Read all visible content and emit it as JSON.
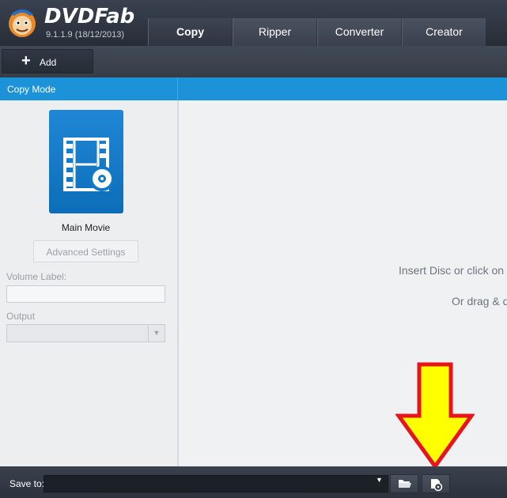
{
  "app": {
    "name": "DVDFab",
    "version": "9.1.1.9 (18/12/2013)"
  },
  "tabs": [
    {
      "label": "Copy",
      "active": true
    },
    {
      "label": "Ripper",
      "active": false
    },
    {
      "label": "Converter",
      "active": false
    },
    {
      "label": "Creator",
      "active": false
    }
  ],
  "toolbar": {
    "add_label": "Add",
    "add_icon": "plus-icon"
  },
  "sidebar": {
    "header": "Copy Mode",
    "mode_tile": {
      "label": "Main Movie",
      "icon": "film-disc-icon"
    },
    "advanced_settings_label": "Advanced Settings",
    "volume_label": {
      "label": "Volume Label:",
      "value": ""
    },
    "output": {
      "label": "Output",
      "value": ""
    }
  },
  "main": {
    "insert_text": "Insert Disc or click on",
    "drag_text": "Or drag & d"
  },
  "annotation": {
    "arrow_color": "#ffff00",
    "arrow_outline": "#e8141c",
    "arrow_icon": "down-arrow-icon"
  },
  "bottom": {
    "save_to_label": "Save to:",
    "save_path": "",
    "folder_icon": "folder-open-icon",
    "iso_icon": "iso-disc-icon"
  },
  "colors": {
    "accent": "#1c92d9",
    "header_bg": "#2f3540",
    "tile_blue": "#1179c8"
  }
}
